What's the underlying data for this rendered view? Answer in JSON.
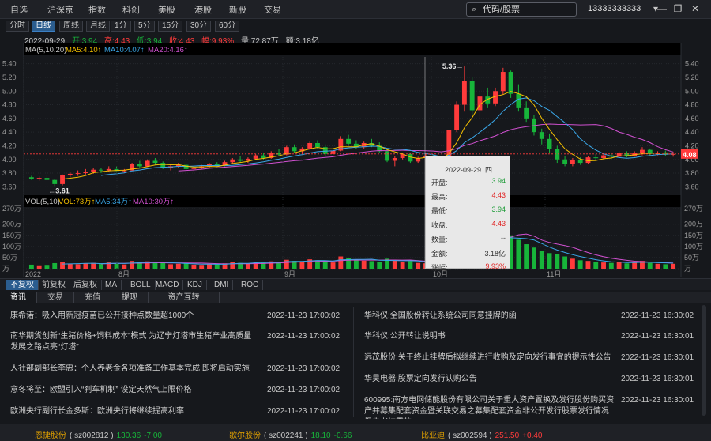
{
  "menu": [
    {
      "label": "自选"
    },
    {
      "label": "沪深京"
    },
    {
      "label": "指数"
    },
    {
      "label": "科创"
    },
    {
      "label": "美股"
    },
    {
      "label": "港股"
    },
    {
      "label": "新股"
    },
    {
      "label": "交易"
    }
  ],
  "search": {
    "placeholder": "代码/股票",
    "icon": "search-icon"
  },
  "account": "13333333333",
  "window_controls": {
    "dropdown": "▾",
    "minimize": "—",
    "restore": "❐",
    "close": "✕"
  },
  "periods": [
    {
      "label": "分时"
    },
    {
      "label": "日线",
      "active": true
    },
    {
      "label": "周线"
    },
    {
      "label": "月线"
    },
    {
      "label": "1分"
    },
    {
      "label": "5分"
    },
    {
      "label": "15分"
    },
    {
      "label": "30分"
    },
    {
      "label": "60分"
    }
  ],
  "info": {
    "date": "2022-09-29",
    "open": "开:3.94",
    "high": "高:4.43",
    "low": "低:3.94",
    "close": "收:4.43",
    "change": "幅:9.93%",
    "volume": "量:72.87万",
    "amount": "额:3.18亿"
  },
  "ma_legend": {
    "title": "MA(5,10,20)",
    "ma5": "MA5:4.10↑",
    "ma10": "MA10:4.07↑",
    "ma20": "MA20:4.16↑"
  },
  "vol_legend": {
    "title": "VOL(5,10)",
    "vol": "VOL:73万↑",
    "ma5": "MA5:34万↑",
    "ma10": "MA10:30万↑"
  },
  "price_axis": [
    "5.40",
    "5.20",
    "5.00",
    "4.80",
    "4.60",
    "4.40",
    "4.20",
    "4.00",
    "3.80",
    "3.60"
  ],
  "vol_axis": [
    "270万",
    "200万",
    "150万",
    "100万",
    "50万",
    "万"
  ],
  "x_axis": [
    "2022",
    "8月",
    "9月",
    "10月",
    "11月"
  ],
  "current_price": "4.08",
  "high_mark": "5.36→",
  "low_mark": "←3.61",
  "colors": {
    "up": "#ff3b3b",
    "down": "#17b53a",
    "ma5": "#f5c100",
    "ma10": "#3aa7e8",
    "ma20": "#d050d0",
    "bg": "#16181c"
  },
  "tooltip": {
    "date": "2022-09-29",
    "weekday": "四",
    "rows": [
      {
        "k": "开盘:",
        "v": "3.94",
        "color": "#1a9a35"
      },
      {
        "k": "最高:",
        "v": "4.43",
        "color": "#e02020"
      },
      {
        "k": "最低:",
        "v": "3.94",
        "color": "#1a9a35"
      },
      {
        "k": "收盘:",
        "v": "4.43",
        "color": "#e02020"
      },
      {
        "k": "数量:",
        "v": "--",
        "color": "#555555"
      },
      {
        "k": "金额:",
        "v": "3.18亿",
        "color": "#333333"
      },
      {
        "k": "涨幅:",
        "v": "9.93%",
        "color": "#e02020"
      }
    ]
  },
  "indicators": [
    {
      "label": "不复权",
      "active": true
    },
    {
      "label": "前复权"
    },
    {
      "label": "后复权"
    },
    {
      "label": "MA"
    },
    {
      "label": "BOLL"
    },
    {
      "label": "MACD"
    },
    {
      "label": "KDJ"
    },
    {
      "label": "DMI"
    },
    {
      "label": "ROC"
    }
  ],
  "news_tabs": [
    {
      "label": "资讯",
      "active": true
    },
    {
      "label": "交易"
    },
    {
      "label": "充值"
    },
    {
      "label": "提现"
    },
    {
      "label": "资产互转"
    }
  ],
  "news_left": [
    {
      "title": "康希诺：吸入用新冠疫苗已公开接种点数量超1000个",
      "date": "2022-11-23 17:00:02"
    },
    {
      "title": "南华期货创新“生猪价格+饲料成本”模式 为辽宁灯塔市生猪产业高质量发展之路点亮“灯塔”",
      "date": "2022-11-23 17:00:02"
    },
    {
      "title": "人社部副部长李忠：个人养老金各项准备工作基本完成 即将启动实施",
      "date": "2022-11-23 17:00:02"
    },
    {
      "title": "意冬将至：欧盟引入“刹车机制” 设定天然气上限价格",
      "date": "2022-11-23 17:00:02"
    },
    {
      "title": "欧洲央行副行长金多斯：欧洲央行将继续提高利率",
      "date": "2022-11-23 17:00:02"
    }
  ],
  "news_right": [
    {
      "title": "华科仪:全国股份转让系统公司同意挂牌的函",
      "date": "2022-11-23 16:30:02"
    },
    {
      "title": "华科仪:公开转让说明书",
      "date": "2022-11-23 16:30:01"
    },
    {
      "title": "远茂股份:关于终止挂牌后拟继续进行收购及定向发行事宜的提示性公告",
      "date": "2022-11-23 16:30:01"
    },
    {
      "title": "华昊电器:股票定向发行认购公告",
      "date": "2022-11-23 16:30:01"
    },
    {
      "title": "600995:南方电网储能股份有限公司关于重大资产置换及发行股份购买资产并募集配套资金暨关联交易之募集配套资金非公开发行股票发行情况报告书披露的",
      "date": "2022-11-23 16:30:01"
    }
  ],
  "ticker": [
    {
      "name": "恩捷股份",
      "code": "( sz002812 )",
      "price": "130.36",
      "change": "-7.00",
      "price_color": "#17b53a",
      "change_color": "#17b53a"
    },
    {
      "name": "歌尔股份",
      "code": "( sz002241 )",
      "price": "18.10",
      "change": "-0.66",
      "price_color": "#17b53a",
      "change_color": "#17b53a"
    },
    {
      "name": "比亚迪",
      "code": "( sz002594 )",
      "price": "251.50",
      "change": "+0.40",
      "price_color": "#ff3b3b",
      "change_color": "#ff3b3b"
    }
  ],
  "chart_data": {
    "type": "candlestick",
    "title": "",
    "price_range": [
      3.5,
      5.5
    ],
    "volume_range": [
      0,
      270
    ],
    "volume_unit": "万",
    "grid": true,
    "candles": [
      [
        3.74,
        3.76,
        3.7,
        3.72,
        18
      ],
      [
        3.72,
        3.75,
        3.69,
        3.73,
        15
      ],
      [
        3.73,
        3.78,
        3.71,
        3.7,
        17
      ],
      [
        3.7,
        3.72,
        3.61,
        3.64,
        25
      ],
      [
        3.64,
        3.78,
        3.62,
        3.77,
        30
      ],
      [
        3.77,
        3.81,
        3.74,
        3.79,
        22
      ],
      [
        3.79,
        3.84,
        3.76,
        3.8,
        20
      ],
      [
        3.8,
        3.86,
        3.78,
        3.82,
        24
      ],
      [
        3.82,
        3.88,
        3.79,
        3.85,
        26
      ],
      [
        3.85,
        3.88,
        3.8,
        3.84,
        21
      ],
      [
        3.84,
        3.9,
        3.82,
        3.86,
        28
      ],
      [
        3.86,
        3.9,
        3.81,
        3.83,
        23
      ],
      [
        3.83,
        3.86,
        3.8,
        3.84,
        19
      ],
      [
        3.84,
        3.95,
        3.83,
        3.93,
        35
      ],
      [
        3.93,
        3.98,
        3.88,
        3.9,
        30
      ],
      [
        3.9,
        4.0,
        3.89,
        3.98,
        33
      ],
      [
        3.98,
        4.02,
        3.92,
        3.95,
        27
      ],
      [
        3.95,
        3.97,
        3.86,
        3.88,
        25
      ],
      [
        3.88,
        3.92,
        3.84,
        3.9,
        20
      ],
      [
        3.9,
        3.95,
        3.88,
        3.92,
        22
      ],
      [
        3.92,
        3.94,
        3.85,
        3.86,
        24
      ],
      [
        3.86,
        3.9,
        3.83,
        3.88,
        18
      ],
      [
        3.88,
        3.92,
        3.86,
        3.9,
        17
      ],
      [
        3.9,
        3.95,
        3.88,
        3.93,
        21
      ],
      [
        3.93,
        3.96,
        3.89,
        3.91,
        19
      ],
      [
        3.91,
        3.98,
        3.9,
        3.96,
        24
      ],
      [
        3.96,
        4.02,
        3.94,
        4.0,
        29
      ],
      [
        4.0,
        4.05,
        3.96,
        3.98,
        26
      ],
      [
        3.98,
        4.03,
        3.95,
        4.01,
        23
      ],
      [
        4.01,
        4.08,
        3.99,
        4.06,
        31
      ],
      [
        4.06,
        4.1,
        4.0,
        4.02,
        27
      ],
      [
        4.02,
        4.12,
        4.01,
        4.1,
        33
      ],
      [
        4.1,
        4.15,
        4.05,
        4.07,
        28
      ],
      [
        4.07,
        4.2,
        4.06,
        4.18,
        40
      ],
      [
        4.18,
        4.22,
        4.1,
        4.12,
        35
      ],
      [
        4.12,
        4.18,
        4.08,
        4.16,
        30
      ],
      [
        4.16,
        4.26,
        4.14,
        4.24,
        42
      ],
      [
        4.24,
        4.28,
        4.15,
        4.18,
        38
      ],
      [
        4.18,
        4.22,
        4.05,
        4.08,
        36
      ],
      [
        4.08,
        4.15,
        4.06,
        4.13,
        28
      ],
      [
        4.13,
        4.34,
        4.12,
        4.3,
        55
      ],
      [
        4.3,
        4.36,
        4.2,
        4.23,
        48
      ],
      [
        4.23,
        4.28,
        4.15,
        4.18,
        40
      ],
      [
        4.18,
        4.26,
        4.16,
        4.24,
        36
      ],
      [
        4.24,
        4.3,
        4.18,
        4.2,
        34
      ],
      [
        4.2,
        4.25,
        4.1,
        4.12,
        32
      ],
      [
        4.12,
        4.16,
        3.96,
        3.98,
        45
      ],
      [
        3.98,
        4.05,
        3.9,
        4.02,
        38
      ],
      [
        4.02,
        4.1,
        4.0,
        4.08,
        30
      ],
      [
        4.08,
        4.1,
        3.95,
        3.97,
        34
      ],
      [
        3.97,
        4.04,
        3.95,
        4.02,
        26
      ],
      [
        4.02,
        4.08,
        3.99,
        4.05,
        24
      ],
      [
        4.05,
        4.07,
        3.96,
        3.98,
        28
      ],
      [
        3.98,
        4.02,
        3.94,
        3.96,
        22
      ],
      [
        3.94,
        4.43,
        3.94,
        4.43,
        73
      ],
      [
        4.43,
        4.85,
        4.4,
        4.8,
        190
      ],
      [
        4.8,
        5.36,
        4.7,
        5.15,
        260
      ],
      [
        5.15,
        5.2,
        4.65,
        4.72,
        175
      ],
      [
        4.72,
        4.98,
        4.6,
        4.92,
        140
      ],
      [
        4.92,
        5.05,
        4.75,
        4.82,
        120
      ],
      [
        4.82,
        5.05,
        4.78,
        5.0,
        125
      ],
      [
        5.0,
        5.34,
        4.95,
        5.28,
        160
      ],
      [
        5.28,
        5.3,
        4.9,
        4.96,
        150
      ],
      [
        4.96,
        5.1,
        4.7,
        4.75,
        130
      ],
      [
        4.75,
        4.85,
        4.55,
        4.6,
        110
      ],
      [
        4.6,
        4.65,
        4.35,
        4.4,
        95
      ],
      [
        4.4,
        4.45,
        4.22,
        4.3,
        80
      ],
      [
        4.3,
        4.38,
        4.1,
        4.15,
        70
      ],
      [
        4.15,
        4.2,
        3.95,
        4.0,
        65
      ],
      [
        4.0,
        4.05,
        3.9,
        3.93,
        55
      ],
      [
        3.93,
        4.02,
        3.9,
        3.99,
        45
      ],
      [
        3.99,
        4.03,
        3.92,
        3.95,
        38
      ],
      [
        3.95,
        4.05,
        3.94,
        4.03,
        35
      ],
      [
        4.03,
        4.08,
        3.98,
        4.02,
        30
      ],
      [
        4.02,
        4.1,
        4.0,
        4.06,
        28
      ],
      [
        4.06,
        4.1,
        4.01,
        4.04,
        26
      ],
      [
        4.04,
        4.12,
        4.02,
        4.1,
        30
      ],
      [
        4.1,
        4.12,
        4.03,
        4.05,
        24
      ],
      [
        4.05,
        4.12,
        4.04,
        4.09,
        28
      ],
      [
        4.09,
        4.18,
        4.06,
        4.14,
        35
      ],
      [
        4.14,
        4.16,
        4.05,
        4.08,
        26
      ],
      [
        4.08,
        4.12,
        4.06,
        4.1,
        22
      ],
      [
        4.1,
        4.13,
        4.05,
        4.07,
        20
      ],
      [
        4.07,
        4.11,
        4.04,
        4.08,
        22
      ]
    ]
  }
}
